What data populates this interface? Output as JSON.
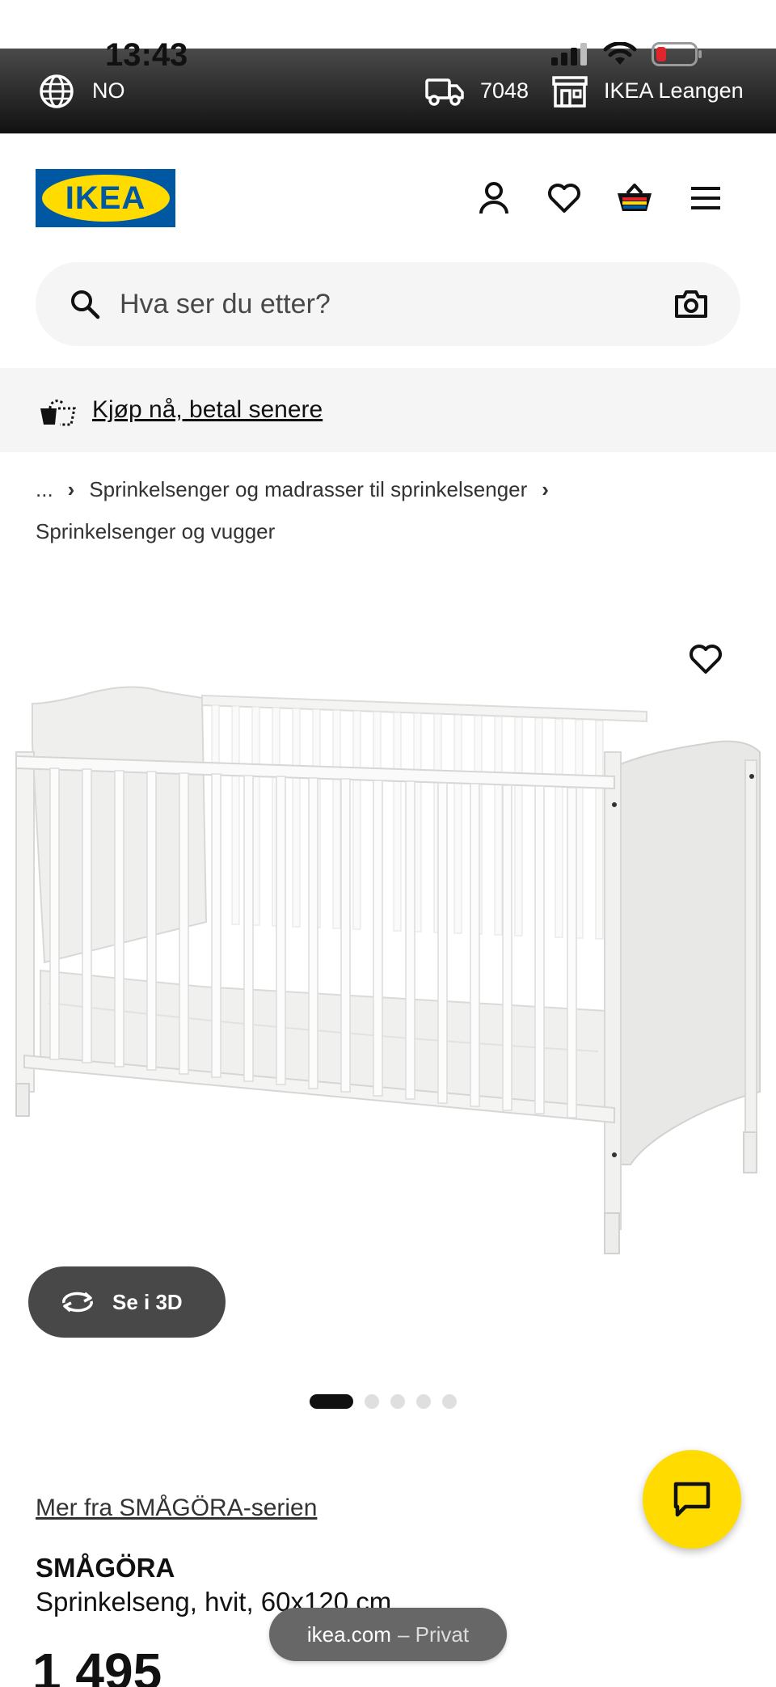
{
  "status_bar": {
    "time": "13:43"
  },
  "top_strip": {
    "language": "NO",
    "postal_code": "7048",
    "store": "IKEA Leangen"
  },
  "header": {
    "logo_text": "IKEA"
  },
  "search": {
    "placeholder": "Hva ser du etter?"
  },
  "promo": {
    "text": "Kjøp nå, betal senere"
  },
  "breadcrumb": {
    "ellipsis": "...",
    "items": [
      "Sprinkelsenger og madrasser til sprinkelsenger",
      "Sprinkelsenger og vugger"
    ]
  },
  "gallery": {
    "view_3d_label": "Se i 3D",
    "image_count": 5,
    "active_index": 0
  },
  "product": {
    "series_link": "Mer fra SMÅGÖRA-serien",
    "name": "SMÅGÖRA",
    "description": "Sprinkelseng, hvit, 60x120 cm",
    "price": "1 495"
  },
  "browser": {
    "domain": "ikea.com",
    "mode": "– Privat"
  },
  "colors": {
    "ikea_blue": "#0058a3",
    "ikea_yellow": "#ffdb00",
    "dark": "#111111",
    "light_gray": "#f5f5f5",
    "battery_low": "#e0262d"
  },
  "icons": [
    "globe-icon",
    "truck-icon",
    "store-icon",
    "account-icon",
    "heart-icon",
    "basket-icon",
    "menu-icon",
    "search-icon",
    "camera-icon",
    "pay-later-icon",
    "rotate-3d-icon",
    "chat-icon"
  ]
}
